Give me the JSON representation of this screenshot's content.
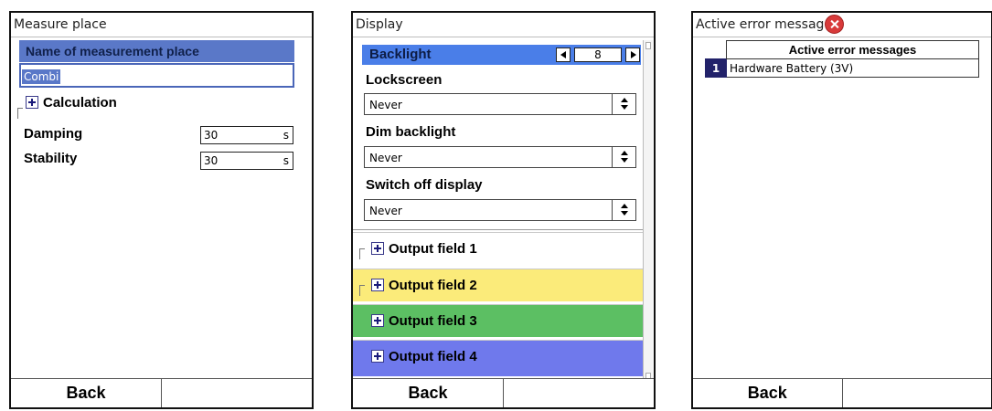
{
  "measure_place": {
    "title": "Measure place",
    "name_header": "Name of measurement place",
    "name_value": "Combi",
    "calculation_label": "Calculation",
    "damping": {
      "label": "Damping",
      "value": "30",
      "unit": "s"
    },
    "stability": {
      "label": "Stability",
      "value": "30",
      "unit": "s"
    },
    "softkeys": [
      "Back",
      ""
    ]
  },
  "display": {
    "title": "Display",
    "backlight": {
      "label": "Backlight",
      "value": "8"
    },
    "lockscreen": {
      "label": "Lockscreen",
      "value": "Never"
    },
    "dim_backlight": {
      "label": "Dim backlight",
      "value": "Never"
    },
    "switch_off": {
      "label": "Switch off display",
      "value": "Never"
    },
    "output_fields": [
      {
        "label": "Output field 1",
        "color": "#ffffff"
      },
      {
        "label": "Output field 2",
        "color": "#fbeb7a"
      },
      {
        "label": "Output field 3",
        "color": "#5cbf63"
      },
      {
        "label": "Output field 4",
        "color": "#6f79ec"
      }
    ],
    "softkeys": [
      "Back",
      ""
    ]
  },
  "errors": {
    "title": "Active error messag",
    "table_header": "Active error messages",
    "rows": [
      {
        "index": "1",
        "message": "Hardware Battery (3V)"
      }
    ],
    "softkeys": [
      "Back",
      ""
    ]
  },
  "colors": {
    "selection_blue": "#5a78c8",
    "backlight_blue": "#4a7ee8",
    "error_red": "#d83a3a"
  }
}
